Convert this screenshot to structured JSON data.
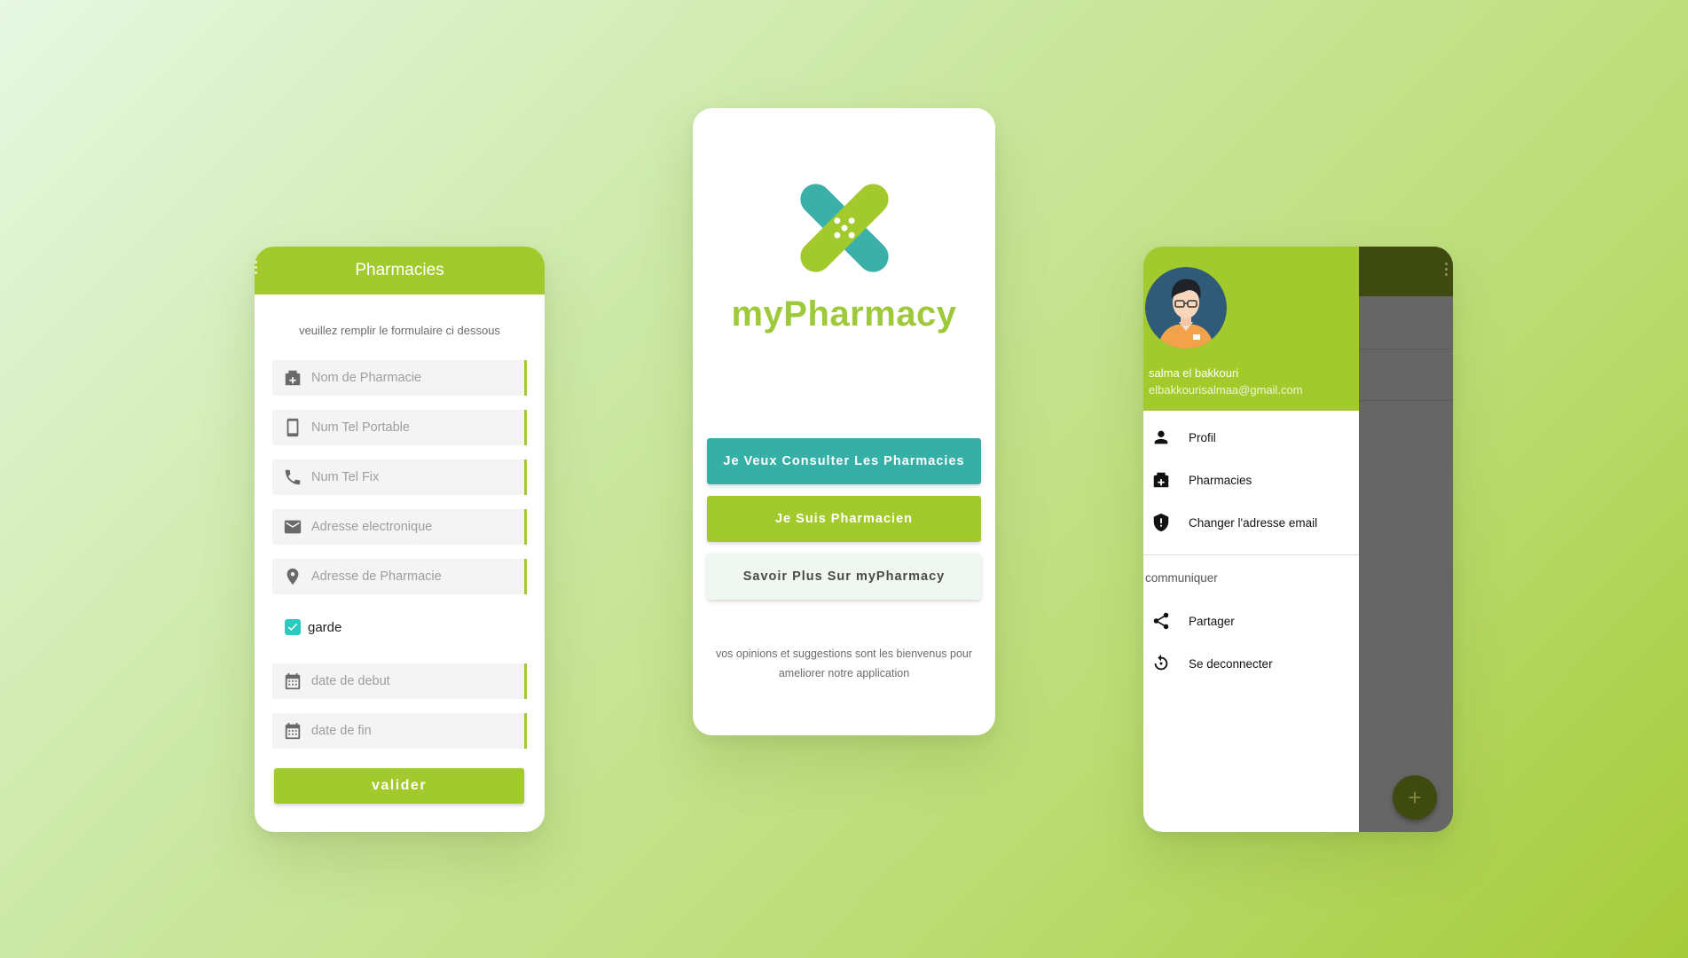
{
  "form_screen": {
    "header_title": "Pharmacies",
    "subtitle": "veuillez remplir le formulaire ci dessous",
    "fields": [
      {
        "placeholder": "Nom de Pharmacie",
        "icon": "pharmacy-icon"
      },
      {
        "placeholder": "Num Tel Portable",
        "icon": "smartphone-icon"
      },
      {
        "placeholder": "Num Tel Fix",
        "icon": "phone-icon"
      },
      {
        "placeholder": "Adresse electronique",
        "icon": "email-icon"
      },
      {
        "placeholder": "Adresse de Pharmacie",
        "icon": "location-pin-icon"
      }
    ],
    "checkbox_label": "garde",
    "checkbox_checked": true,
    "date_fields": [
      {
        "placeholder": "date de debut",
        "icon": "calendar-icon"
      },
      {
        "placeholder": "date de fin",
        "icon": "calendar-icon"
      }
    ],
    "submit_label": "valider"
  },
  "home_screen": {
    "brand": "myPharmacy",
    "buttons": {
      "consult": "Je Veux Consulter Les Pharmacies",
      "pharmacist": "Je Suis Pharmacien",
      "about": "Savoir Plus Sur myPharmacy"
    },
    "footer_note": "vos opinions et suggestions sont les bienvenus pour ameliorer notre application"
  },
  "drawer_screen": {
    "user_name": "salma el bakkouri",
    "user_email": "elbakkourisalmaa@gmail.com",
    "menu": [
      {
        "label": "Profil",
        "icon": "person-icon"
      },
      {
        "label": "Pharmacies",
        "icon": "pharmacy-icon"
      },
      {
        "label": "Changer l'adresse email",
        "icon": "shield-icon"
      }
    ],
    "section_label": "communiquer",
    "menu2": [
      {
        "label": "Partager",
        "icon": "share-icon"
      },
      {
        "label": "Se deconnecter",
        "icon": "logout-icon"
      }
    ],
    "fab_label": "+"
  },
  "colors": {
    "brand_green": "#a3ca2c",
    "teal": "#36b0a7",
    "dark_toolbar": "#3f4a10"
  }
}
